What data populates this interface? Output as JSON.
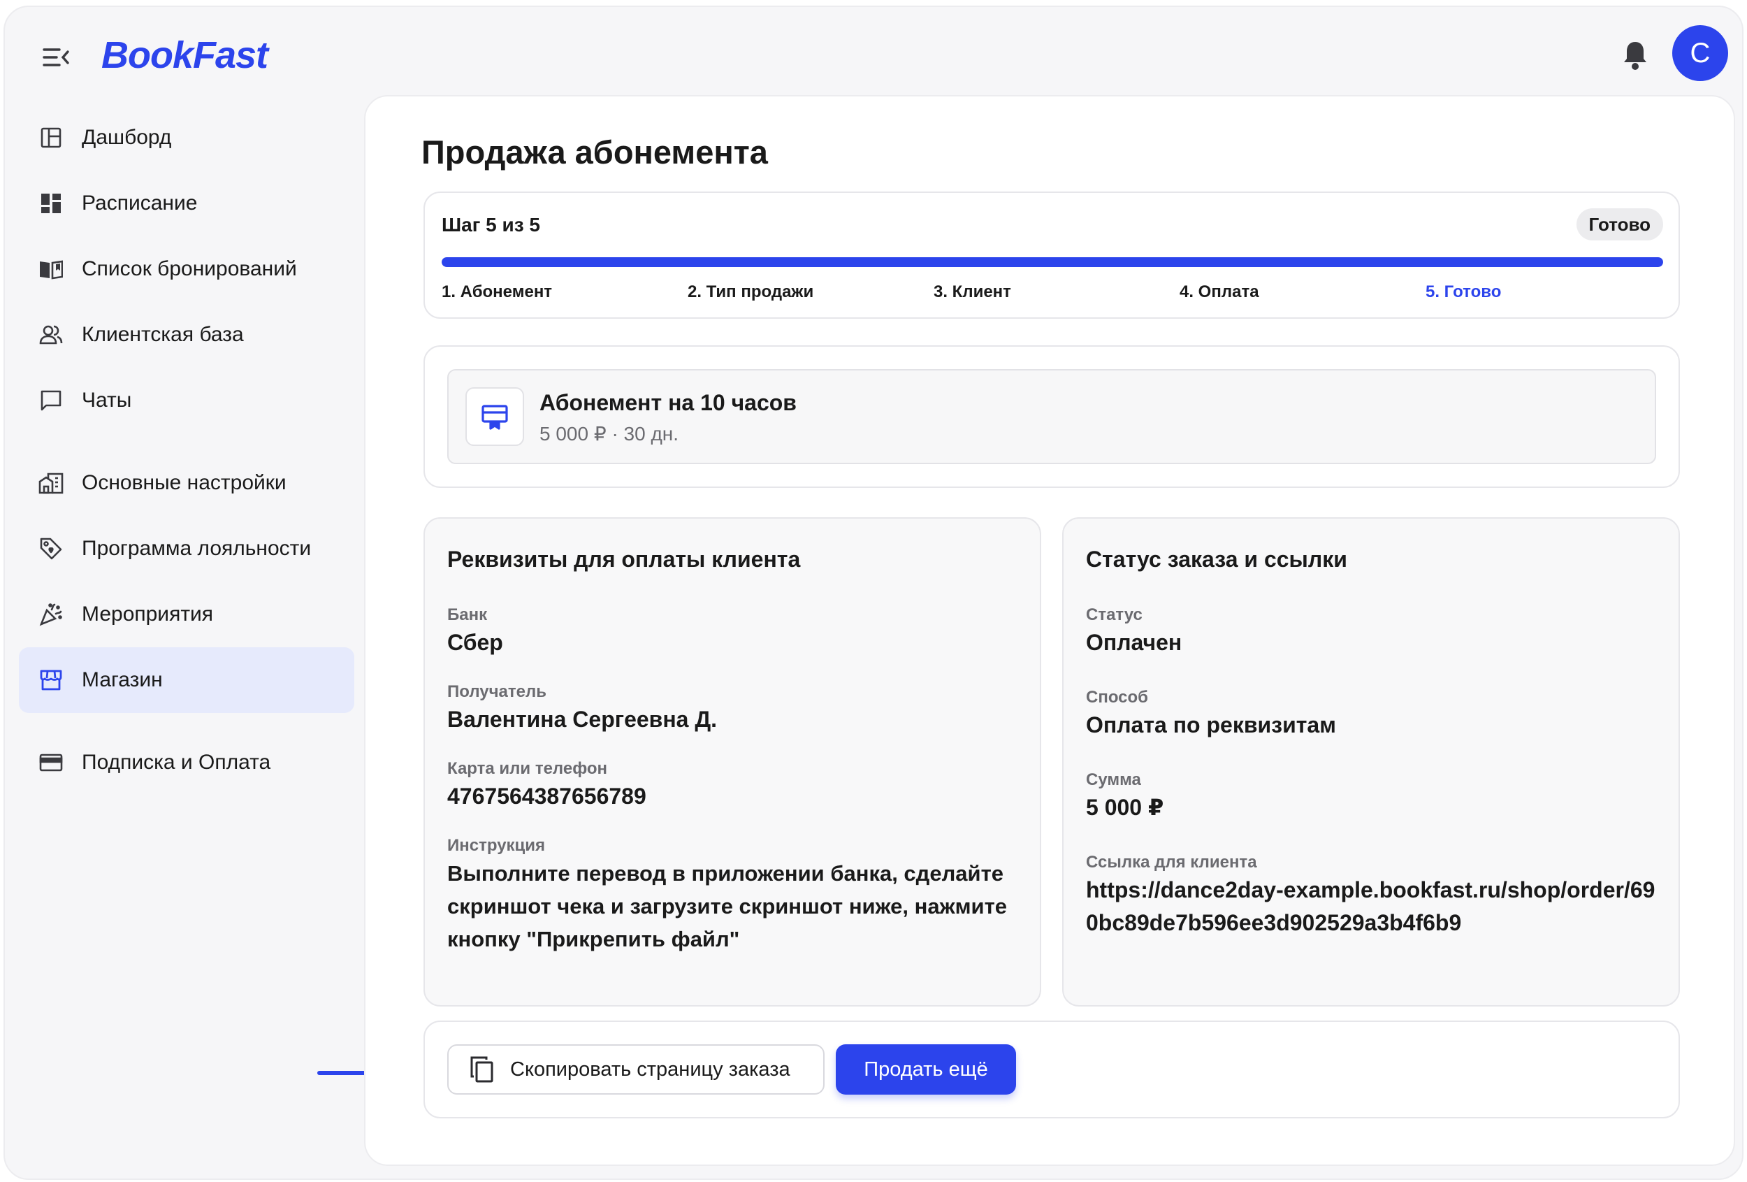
{
  "header": {
    "logo_text": "BookFast",
    "avatar_initial": "C",
    "brand_color": "#2c44ec"
  },
  "sidebar": {
    "items": [
      {
        "label": "Дашборд",
        "icon": "dashboard-icon"
      },
      {
        "label": "Расписание",
        "icon": "schedule-icon"
      },
      {
        "label": "Список бронирований",
        "icon": "bookings-icon"
      },
      {
        "label": "Клиентская база",
        "icon": "clients-icon"
      },
      {
        "label": "Чаты",
        "icon": "chat-icon"
      },
      {
        "label": "Основные настройки",
        "icon": "settings-building-icon"
      },
      {
        "label": "Программа лояльности",
        "icon": "loyalty-tag-icon"
      },
      {
        "label": "Мероприятия",
        "icon": "party-icon"
      },
      {
        "label": "Магазин",
        "icon": "store-icon",
        "active": true
      },
      {
        "label": "Подписка и Оплата",
        "icon": "card-icon"
      }
    ]
  },
  "main": {
    "title": "Продажа абонемента",
    "stepper": {
      "title": "Шаг 5 из 5",
      "badge": "Готово",
      "progress": 1.0,
      "steps": [
        "1. Абонемент",
        "2. Тип продажи",
        "3. Клиент",
        "4. Оплата",
        "5. Готово"
      ],
      "current_step": 5
    },
    "plan": {
      "name": "Абонемент на 10 часов",
      "meta": "5 000 ₽ · 30 дн."
    },
    "payment_details": {
      "title": "Реквизиты для оплаты клиента",
      "bank_label": "Банк",
      "bank_value": "Сбер",
      "recipient_label": "Получатель",
      "recipient_value": "Валентина Сергеевна Д.",
      "card_label": "Карта или телефон",
      "card_value": "4767564387656789",
      "instruction_label": "Инструкция",
      "instruction_value": "Выполните перевод в приложении банка, сделайте скриншот чека и загрузите скриншот ниже, нажмите кнопку \"Прикрепить файл\""
    },
    "order_status": {
      "title": "Статус заказа и ссылки",
      "status_label": "Статус",
      "status_value": "Оплачен",
      "method_label": "Способ",
      "method_value": "Оплата по реквизитам",
      "sum_label": "Сумма",
      "sum_value": "5 000 ₽",
      "link_label": "Ссылка для клиента",
      "link_value": "https://dance2day-example.bookfast.ru/shop/order/690bc89de7b596ee3d902529a3b4f6b9"
    },
    "actions": {
      "copy_label": "Скопировать страницу заказа",
      "sell_more_label": "Продать ещё"
    }
  }
}
